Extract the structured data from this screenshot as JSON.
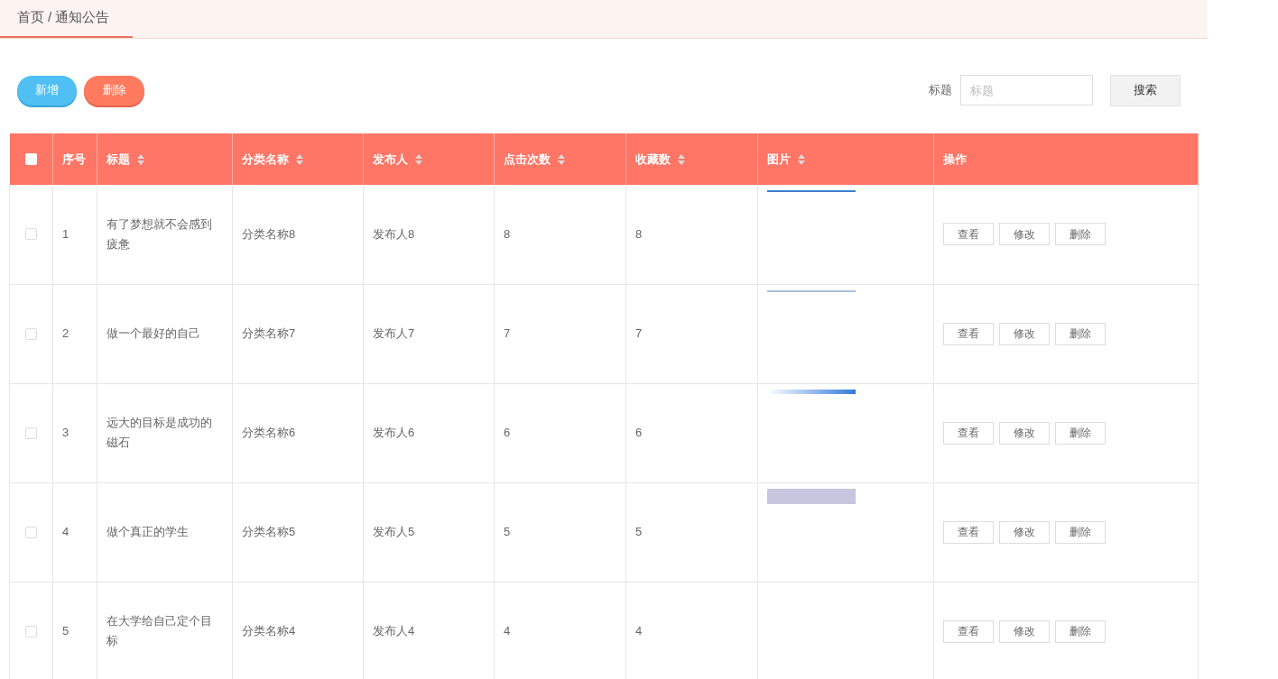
{
  "breadcrumb": {
    "home": "首页",
    "separator": "/",
    "current": "通知公告"
  },
  "toolbar": {
    "add_button": "新增",
    "delete_button": "删除"
  },
  "search": {
    "label": "标题",
    "placeholder": "标题",
    "button": "搜索"
  },
  "table": {
    "select_all_checked": false,
    "columns": [
      {
        "label": "序号",
        "sortable": false
      },
      {
        "label": "标题",
        "sortable": true
      },
      {
        "label": "分类名称",
        "sortable": true
      },
      {
        "label": "发布人",
        "sortable": true
      },
      {
        "label": "点击次数",
        "sortable": true
      },
      {
        "label": "收藏数",
        "sortable": true
      },
      {
        "label": "图片",
        "sortable": true
      },
      {
        "label": "操作",
        "sortable": false
      }
    ],
    "rows": [
      {
        "checked": false,
        "index": "1",
        "title": "有了梦想就不会感到疲惫",
        "category": "分类名称8",
        "publisher": "发布人8",
        "clicks": "8",
        "favorites": "8",
        "has_image": true,
        "actions": [
          "查看",
          "修改",
          "删除"
        ]
      },
      {
        "checked": false,
        "index": "2",
        "title": "做一个最好的自己",
        "category": "分类名称7",
        "publisher": "发布人7",
        "clicks": "7",
        "favorites": "7",
        "has_image": true,
        "actions": [
          "查看",
          "修改",
          "删除"
        ]
      },
      {
        "checked": false,
        "index": "3",
        "title": "远大的目标是成功的磁石",
        "category": "分类名称6",
        "publisher": "发布人6",
        "clicks": "6",
        "favorites": "6",
        "has_image": true,
        "actions": [
          "查看",
          "修改",
          "删除"
        ]
      },
      {
        "checked": false,
        "index": "4",
        "title": "做个真正的学生",
        "category": "分类名称5",
        "publisher": "发布人5",
        "clicks": "5",
        "favorites": "5",
        "has_image": true,
        "actions": [
          "查看",
          "修改",
          "删除"
        ]
      },
      {
        "checked": false,
        "index": "5",
        "title": "在大学给自己定个目标",
        "category": "分类名称4",
        "publisher": "发布人4",
        "clicks": "4",
        "favorites": "4",
        "has_image": false,
        "actions": [
          "查看",
          "修改",
          "删除"
        ]
      }
    ]
  }
}
